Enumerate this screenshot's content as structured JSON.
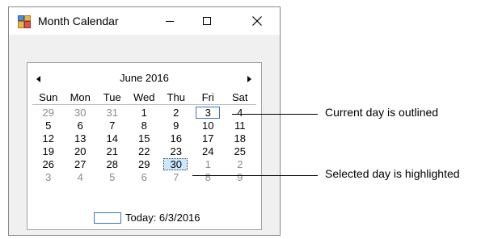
{
  "window": {
    "title": "Month Calendar",
    "icon": "windows-form-icon"
  },
  "calendar": {
    "month_title": "June 2016",
    "prev_icon": "left-arrow-icon",
    "next_icon": "right-arrow-icon",
    "days_of_week": [
      "Sun",
      "Mon",
      "Tue",
      "Wed",
      "Thu",
      "Fri",
      "Sat"
    ],
    "weeks": [
      [
        {
          "d": "29",
          "other": true
        },
        {
          "d": "30",
          "other": true
        },
        {
          "d": "31",
          "other": true
        },
        {
          "d": "1"
        },
        {
          "d": "2"
        },
        {
          "d": "3",
          "today": true
        },
        {
          "d": "4"
        }
      ],
      [
        {
          "d": "5"
        },
        {
          "d": "6"
        },
        {
          "d": "7"
        },
        {
          "d": "8"
        },
        {
          "d": "9"
        },
        {
          "d": "10"
        },
        {
          "d": "11"
        }
      ],
      [
        {
          "d": "12"
        },
        {
          "d": "13"
        },
        {
          "d": "14"
        },
        {
          "d": "15"
        },
        {
          "d": "16"
        },
        {
          "d": "17"
        },
        {
          "d": "18"
        }
      ],
      [
        {
          "d": "19"
        },
        {
          "d": "20"
        },
        {
          "d": "21"
        },
        {
          "d": "22"
        },
        {
          "d": "23"
        },
        {
          "d": "24"
        },
        {
          "d": "25"
        }
      ],
      [
        {
          "d": "26"
        },
        {
          "d": "27"
        },
        {
          "d": "28"
        },
        {
          "d": "29"
        },
        {
          "d": "30",
          "selected": true
        },
        {
          "d": "1",
          "other": true
        },
        {
          "d": "2",
          "other": true
        }
      ],
      [
        {
          "d": "3",
          "other": true
        },
        {
          "d": "4",
          "other": true
        },
        {
          "d": "5",
          "other": true
        },
        {
          "d": "6",
          "other": true
        },
        {
          "d": "7",
          "other": true
        },
        {
          "d": "8",
          "other": true
        },
        {
          "d": "9",
          "other": true
        }
      ]
    ],
    "today_label": "Today: 6/3/2016"
  },
  "callouts": {
    "current_day": "Current day is outlined",
    "selected_day": "Selected day is highlighted"
  }
}
